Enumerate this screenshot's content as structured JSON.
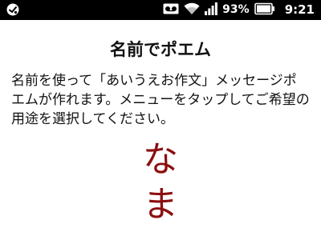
{
  "status_bar": {
    "battery_percent": "93%",
    "time": "9:21",
    "icons": [
      "notification-icon",
      "voicemail-icon",
      "wifi-icon",
      "signal-icon",
      "battery-icon"
    ]
  },
  "page": {
    "title": "名前でポエム",
    "description": "名前を使って「あいうえお作文」メッセージポエムが作れます。メニューをタップしてご希望の用途を選択してください。",
    "poem_chars": [
      "な",
      "ま"
    ],
    "accent_color": "#8b0e0e"
  }
}
